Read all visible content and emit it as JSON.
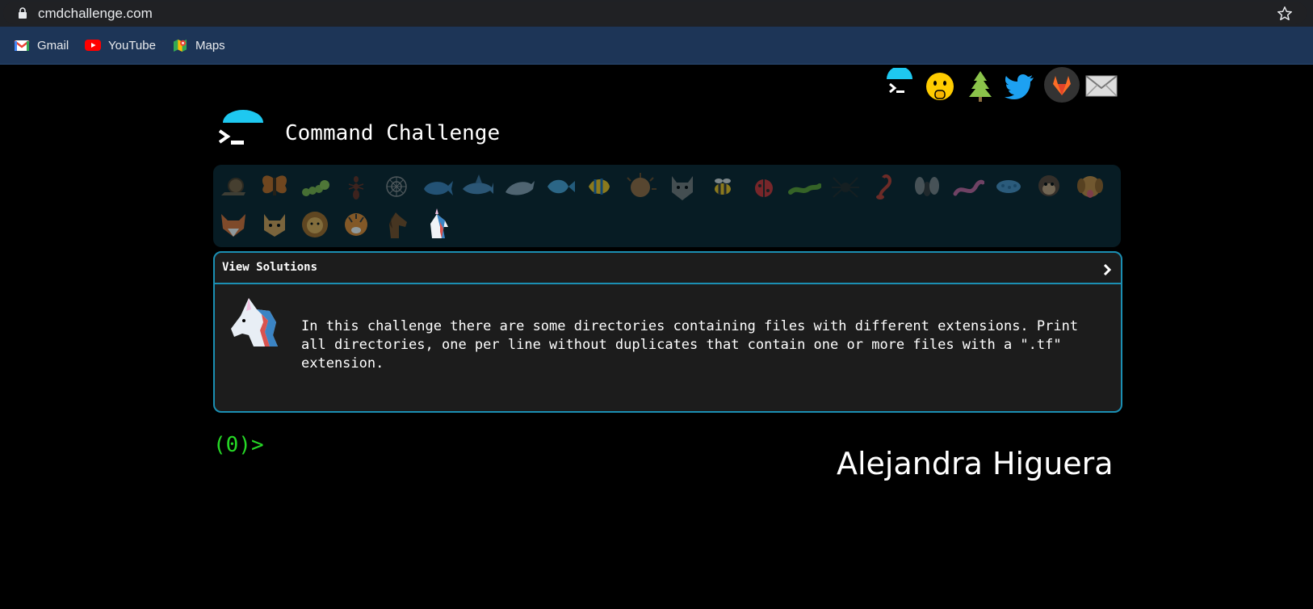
{
  "browser": {
    "url": "cmdchallenge.com",
    "bookmarks": [
      {
        "label": "Gmail",
        "icon": "gmail-icon"
      },
      {
        "label": "YouTube",
        "icon": "youtube-icon"
      },
      {
        "label": "Maps",
        "icon": "maps-icon"
      }
    ]
  },
  "header": {
    "title": "Command Challenge",
    "social_icons": [
      "terminal-logo-icon",
      "shush-face-icon",
      "tree-icon",
      "twitter-icon",
      "gitlab-icon",
      "envelope-icon"
    ]
  },
  "challenges": {
    "icons": [
      "snail",
      "butterfly",
      "caterpillar",
      "ant",
      "web",
      "whale",
      "shark",
      "dolphin",
      "fish",
      "tropical-fish",
      "blowfish",
      "wolf",
      "bee",
      "ladybug",
      "worm",
      "spider",
      "scorpion",
      "fly",
      "snake",
      "microbe",
      "monkey",
      "dog",
      "fox",
      "cat",
      "lion",
      "tiger",
      "horse",
      "unicorn"
    ]
  },
  "panel": {
    "title": "View Solutions",
    "icon": "unicorn-icon",
    "description": "In this challenge there are some directories containing files with different extensions. Print all directories, one per line without duplicates that contain one or more files with a \".tf\" extension."
  },
  "terminal": {
    "prompt": "(0)>",
    "input_value": ""
  },
  "author": "Alejandra Higuera",
  "colors": {
    "accent": "#1b8fb3",
    "prompt_green": "#26d926",
    "bookmark_bar": "#1d3557",
    "challenge_bar": "#071c24"
  }
}
